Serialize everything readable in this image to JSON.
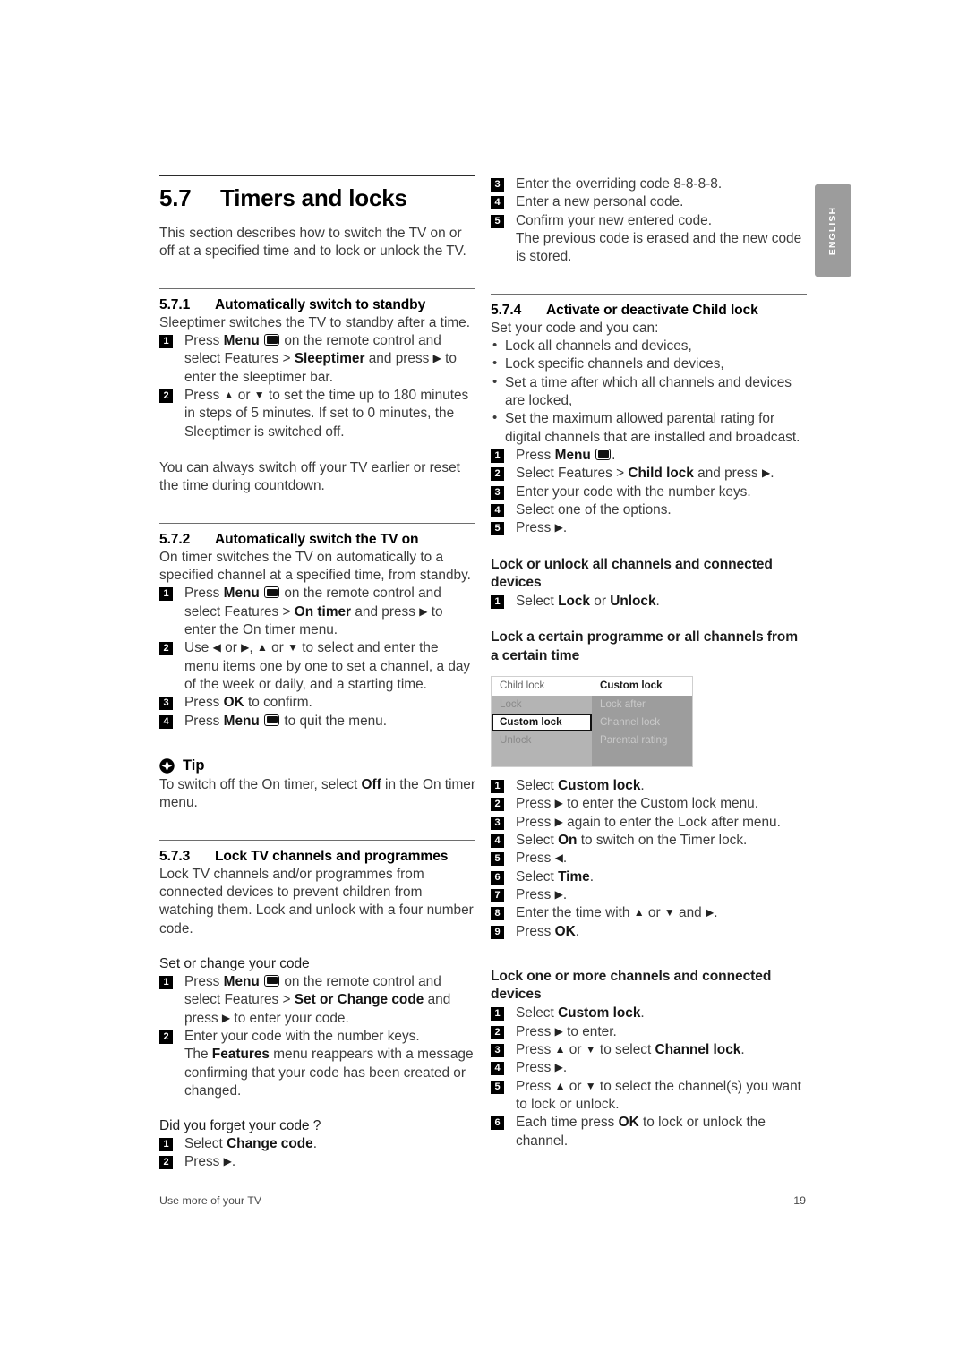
{
  "sidetab": {
    "label": "ENGLISH"
  },
  "footer": {
    "left": "Use more of your TV",
    "page": "19"
  },
  "left": {
    "section": {
      "num": "5.7",
      "title": "Timers and locks"
    },
    "intro": "This section describes how to switch the TV on or off at a specified time and to lock or unlock the TV.",
    "s571": {
      "num": "5.7.1",
      "title": "Automatically switch to standby",
      "lead": "Sleeptimer switches the TV to standby after a time.",
      "steps": [
        {
          "n": "1",
          "parts": [
            "Press ",
            "Menu",
            " ",
            "[menu-icon]",
            " on the remote control and select Features > ",
            "Sleeptimer",
            " and press ",
            "[arrow-right]",
            " to enter the sleeptimer bar."
          ]
        },
        {
          "n": "2",
          "parts": [
            "Press ",
            "[arrow-up]",
            " or ",
            "[arrow-down]",
            " to set the time up to 180 minutes in steps of 5 minutes. If set to 0 minutes, the Sleeptimer is switched off."
          ]
        }
      ],
      "after": "You can always switch off your TV earlier or reset the time during countdown."
    },
    "s572": {
      "num": "5.7.2",
      "title": "Automatically switch the TV on",
      "lead": "On timer switches the TV on automatically to a specified channel at a specified time, from standby.",
      "steps": [
        {
          "n": "1",
          "text": "Press Menu [menu-icon] on the remote control and select Features > On timer and press [arrow-right] to enter the On timer menu."
        },
        {
          "n": "2",
          "text": "Use [arrow-left] or [arrow-right], [arrow-up] or [arrow-down] to select and enter the menu items one by one to set a channel, a day of the week or daily, and a starting time."
        },
        {
          "n": "3",
          "text": "Press OK to confirm."
        },
        {
          "n": "4",
          "text": "Press Menu [menu-icon] to quit the menu."
        }
      ]
    },
    "tip": {
      "label": "Tip",
      "text": "To switch off the On timer, select Off in the On timer menu."
    },
    "s573": {
      "num": "5.7.3",
      "title": "Lock TV channels and programmes",
      "lead": "Lock TV channels and/or programmes from connected devices to prevent children from watching them. Lock and unlock with a four number code.",
      "sub1": "Set or change your code",
      "steps1": [
        {
          "n": "1",
          "text": "Press Menu [menu-icon] on the remote control and select Features > Set or Change code and press [arrow-right] to enter your code."
        },
        {
          "n": "2",
          "text": "Enter your code with the number keys."
        },
        {
          "n": "",
          "text": "The Features menu reappears with a message confirming that your code has been created or changed."
        }
      ],
      "sub2": "Did you forget your code ?",
      "steps2": [
        {
          "n": "1",
          "text": "Select Change code."
        },
        {
          "n": "2",
          "text": "Press [arrow-right]."
        }
      ]
    }
  },
  "right": {
    "top_steps": [
      {
        "n": "3",
        "text": "Enter the overriding code 8-8-8-8."
      },
      {
        "n": "4",
        "text": "Enter a new personal code."
      },
      {
        "n": "5",
        "text": "Confirm your new entered code."
      },
      {
        "n": "",
        "text": "The previous code is erased and the new code is stored."
      }
    ],
    "s574": {
      "num": "5.7.4",
      "title": "Activate or deactivate Child lock",
      "lead": "Set your code and you can:",
      "bullets": [
        "Lock all channels and devices,",
        "Lock specific channels and devices,",
        "Set a time after which all channels and devices are locked,",
        "Set the maximum allowed parental rating for digital channels that are installed and broadcast."
      ],
      "steps": [
        {
          "n": "1",
          "text": "Press Menu [menu-icon]."
        },
        {
          "n": "2",
          "text": "Select Features > Child lock and press [arrow-right]."
        },
        {
          "n": "3",
          "text": "Enter your code with the number keys."
        },
        {
          "n": "4",
          "text": "Select one of the options."
        },
        {
          "n": "5",
          "text": "Press [arrow-right]."
        }
      ]
    },
    "block_lock_all": {
      "title": "Lock or unlock all channels and connected devices",
      "steps": [
        {
          "n": "1",
          "text": "Select Lock or Unlock."
        }
      ]
    },
    "block_certain": {
      "title": "Lock a certain programme or all channels from a certain time",
      "steps": [
        {
          "n": "1",
          "text": "Select Custom lock."
        },
        {
          "n": "2",
          "text": "Press [arrow-right] to enter the Custom lock menu."
        },
        {
          "n": "3",
          "text": "Press [arrow-right] again to enter the Lock after menu."
        },
        {
          "n": "4",
          "text": "Select On to switch on the Timer lock."
        },
        {
          "n": "5",
          "text": "Press [arrow-left]."
        },
        {
          "n": "6",
          "text": "Select Time."
        },
        {
          "n": "7",
          "text": "Press [arrow-right]."
        },
        {
          "n": "8",
          "text": "Enter the time with [arrow-up] or [arrow-down] and [arrow-right]."
        },
        {
          "n": "9",
          "text": "Press OK."
        }
      ]
    },
    "block_lock_one": {
      "title": "Lock one or more channels and connected devices",
      "steps": [
        {
          "n": "1",
          "text": "Select Custom lock."
        },
        {
          "n": "2",
          "text": "Press [arrow-right] to enter."
        },
        {
          "n": "3",
          "text": "Press [arrow-up] or [arrow-down] to select Channel lock."
        },
        {
          "n": "4",
          "text": "Press [arrow-right]."
        },
        {
          "n": "5",
          "text": "Press [arrow-up] or [arrow-down] to select the channel(s) you want to lock or unlock."
        },
        {
          "n": "6",
          "text": "Each time press OK to lock or unlock the channel."
        }
      ]
    },
    "tvmenu": {
      "header_left": "Child lock",
      "header_right": "Custom lock",
      "left_items": [
        "Lock",
        "Custom lock",
        "Unlock"
      ],
      "selected_left": "Custom lock",
      "right_items": [
        "Lock after",
        "Channel lock",
        "Parental rating"
      ]
    }
  }
}
